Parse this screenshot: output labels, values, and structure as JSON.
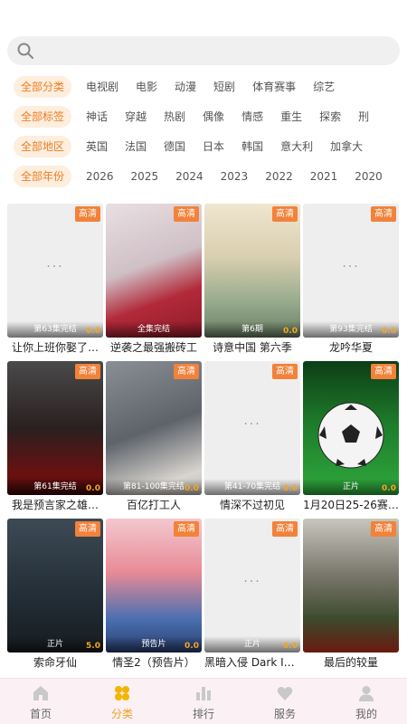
{
  "search": {
    "placeholder": ""
  },
  "filters": [
    {
      "label": "全部分类",
      "options": [
        "电视剧",
        "电影",
        "动漫",
        "短剧",
        "体育赛事",
        "综艺"
      ]
    },
    {
      "label": "全部标签",
      "options": [
        "神话",
        "穿越",
        "热剧",
        "偶像",
        "情感",
        "重生",
        "探索",
        "刑"
      ]
    },
    {
      "label": "全部地区",
      "options": [
        "英国",
        "法国",
        "德国",
        "日本",
        "韩国",
        "意大利",
        "加拿大"
      ]
    },
    {
      "label": "全部年份",
      "options": [
        "2026",
        "2025",
        "2024",
        "2023",
        "2022",
        "2021",
        "2020"
      ]
    }
  ],
  "items": [
    {
      "title": "让你上班你娶了…",
      "badge": "高清",
      "status": "第63集完结",
      "score": "0.0"
    },
    {
      "title": "逆袭之最强搬砖工",
      "badge": "高清",
      "status": "全集完结",
      "score": ""
    },
    {
      "title": "诗意中国 第六季",
      "badge": "高清",
      "status": "第6期",
      "score": "0.0"
    },
    {
      "title": "龙吟华夏",
      "badge": "高清",
      "status": "第93集完结",
      "score": "0.0"
    },
    {
      "title": "我是预言家之雄…",
      "badge": "高清",
      "status": "第61集完结",
      "score": "0.0"
    },
    {
      "title": "百亿打工人",
      "badge": "高清",
      "status": "第81-100集完结",
      "score": "0.0"
    },
    {
      "title": "情深不过初见",
      "badge": "高清",
      "status": "第41-70集完结",
      "score": "0.0"
    },
    {
      "title": "1月20日25-26赛…",
      "badge": "高清",
      "status": "正片",
      "score": "0.0"
    },
    {
      "title": "索命牙仙",
      "badge": "高清",
      "status": "正片",
      "score": "5.0"
    },
    {
      "title": "情圣2（预告片）",
      "badge": "高清",
      "status": "预告片",
      "score": "0.0"
    },
    {
      "title": "黑暗入侵 Dark Inv…",
      "badge": "高清",
      "status": "正片",
      "score": "0.0"
    },
    {
      "title": "最后的较量",
      "badge": "高清",
      "status": "",
      "score": ""
    }
  ],
  "tabs": [
    {
      "label": "首页",
      "icon": "home-icon"
    },
    {
      "label": "分类",
      "icon": "category-icon"
    },
    {
      "label": "排行",
      "icon": "ranking-icon"
    },
    {
      "label": "服务",
      "icon": "heart-icon"
    },
    {
      "label": "我的",
      "icon": "user-icon"
    }
  ],
  "active_tab": "分类",
  "colors": {
    "accent": "#ef7d22",
    "badge": "#f2823a",
    "tab_active": "#f0a020"
  }
}
